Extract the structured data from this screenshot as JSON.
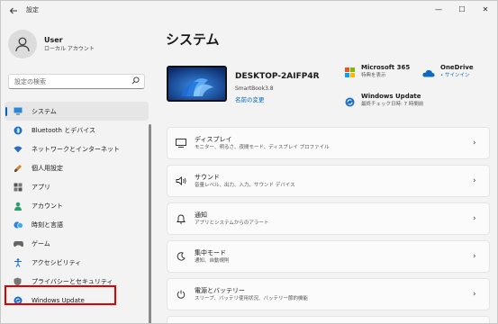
{
  "window": {
    "app_title": "設定",
    "controls": {
      "minimize": "—",
      "maximize": "☐",
      "close": "✕"
    }
  },
  "user": {
    "name": "User",
    "account_type": "ローカル アカウント"
  },
  "search": {
    "placeholder": "設定の検索"
  },
  "sidebar": {
    "items": [
      {
        "label": "システム",
        "icon": "system-icon",
        "active": true
      },
      {
        "label": "Bluetooth とデバイス",
        "icon": "bluetooth-icon"
      },
      {
        "label": "ネットワークとインターネット",
        "icon": "wifi-icon"
      },
      {
        "label": "個人用設定",
        "icon": "brush-icon"
      },
      {
        "label": "アプリ",
        "icon": "apps-icon"
      },
      {
        "label": "アカウント",
        "icon": "person-icon"
      },
      {
        "label": "時刻と言語",
        "icon": "clock-globe-icon"
      },
      {
        "label": "ゲーム",
        "icon": "gamepad-icon"
      },
      {
        "label": "アクセシビリティ",
        "icon": "accessibility-icon"
      },
      {
        "label": "プライバシーとセキュリティ",
        "icon": "shield-icon"
      },
      {
        "label": "Windows Update",
        "icon": "windows-update-icon"
      }
    ]
  },
  "main": {
    "title": "システム",
    "device": {
      "name": "DESKTOP-2AIFP4R",
      "model": "SmartBook3.8",
      "rename_link": "名前の変更"
    },
    "quick": {
      "m365": {
        "title": "Microsoft 365",
        "sub": "特典を表示"
      },
      "onedrive": {
        "title": "OneDrive",
        "sub": "• サインイン"
      },
      "update": {
        "title": "Windows Update",
        "sub": "最終チェック日時: 7 時間前"
      }
    },
    "cards": [
      {
        "title": "ディスプレイ",
        "sub": "モニター、明るさ、夜間モード、ディスプレイ プロファイル",
        "icon": "display-icon"
      },
      {
        "title": "サウンド",
        "sub": "音量レベル、出力、入力、サウンド デバイス",
        "icon": "speaker-icon"
      },
      {
        "title": "通知",
        "sub": "アプリとシステムからのアラート",
        "icon": "bell-icon"
      },
      {
        "title": "集中モード",
        "sub": "通知、自動規則",
        "icon": "moon-icon"
      },
      {
        "title": "電源とバッテリー",
        "sub": "スリープ、バッテリ使用状況、バッテリー節約機能",
        "icon": "power-icon"
      }
    ]
  },
  "colors": {
    "accent": "#0067c0",
    "highlight": "#e00000"
  }
}
